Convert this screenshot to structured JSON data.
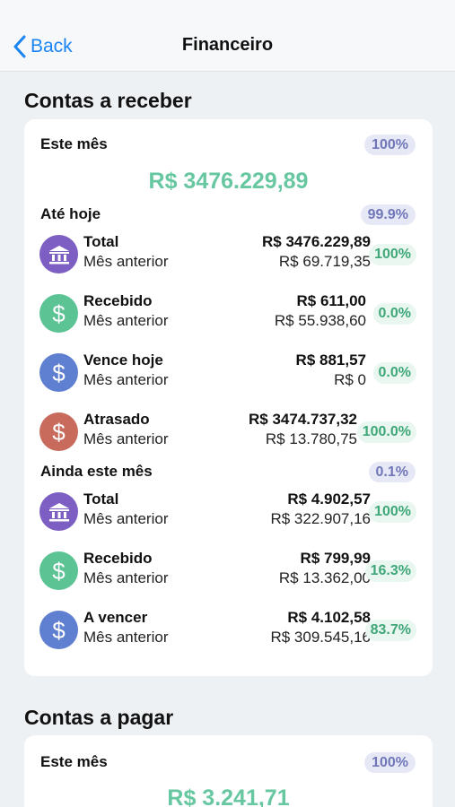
{
  "nav": {
    "back_label": "Back",
    "title": "Financeiro"
  },
  "receber": {
    "title": "Contas a receber",
    "este_mes": {
      "label": "Este mês",
      "pct": "100%",
      "amount": "R$ 3476.229,89"
    },
    "ate_hoje": {
      "label": "Até hoje",
      "pct": "99.9%",
      "rows": [
        {
          "icon": "bank-icon",
          "color": "#7d5ec2",
          "title": "Total",
          "sub": "Mês anterior",
          "value": "R$ 3476.229,89",
          "prev": "R$ 69.719,35",
          "pct": "100%"
        },
        {
          "icon": "dollar-icon",
          "color": "#5bc394",
          "title": "Recebido",
          "sub": "Mês anterior",
          "value": "R$ 611,00",
          "prev": "R$ 55.938,60",
          "pct": "0.0%"
        },
        {
          "icon": "dollar-icon",
          "color": "#5f7fd0",
          "title": "Vence hoje",
          "sub": "Mês anterior",
          "value": "R$ 881,57",
          "prev": "R$ 0",
          "pct": "0.0%"
        },
        {
          "icon": "dollar-icon",
          "color": "#c96b5c",
          "title": "Atrasado",
          "sub": "Mês anterior",
          "value": "R$ 3474.737,32",
          "prev": "R$ 13.780,75",
          "pct": "100.0%"
        }
      ]
    },
    "ainda": {
      "label": "Ainda este mês",
      "pct": "0.1%",
      "rows": [
        {
          "icon": "bank-icon",
          "color": "#7d5ec2",
          "title": "Total",
          "sub": "Mês anterior",
          "value": "R$ 4.902,57",
          "prev": "R$ 322.907,16",
          "pct": "100%"
        },
        {
          "icon": "dollar-icon",
          "color": "#5bc394",
          "title": "Recebido",
          "sub": "Mês anterior",
          "value": "R$ 799,99",
          "prev": "R$ 13.362,00",
          "pct": "16.3%"
        },
        {
          "icon": "dollar-icon",
          "color": "#5f7fd0",
          "title": "A vencer",
          "sub": "Mês anterior",
          "value": "R$ 4.102,58",
          "prev": "R$ 309.545,16",
          "pct": "83.7%"
        }
      ]
    }
  },
  "pagar": {
    "title": "Contas a pagar",
    "este_mes": {
      "label": "Este mês",
      "pct": "100%",
      "amount": "R$ 3.241,71"
    }
  }
}
